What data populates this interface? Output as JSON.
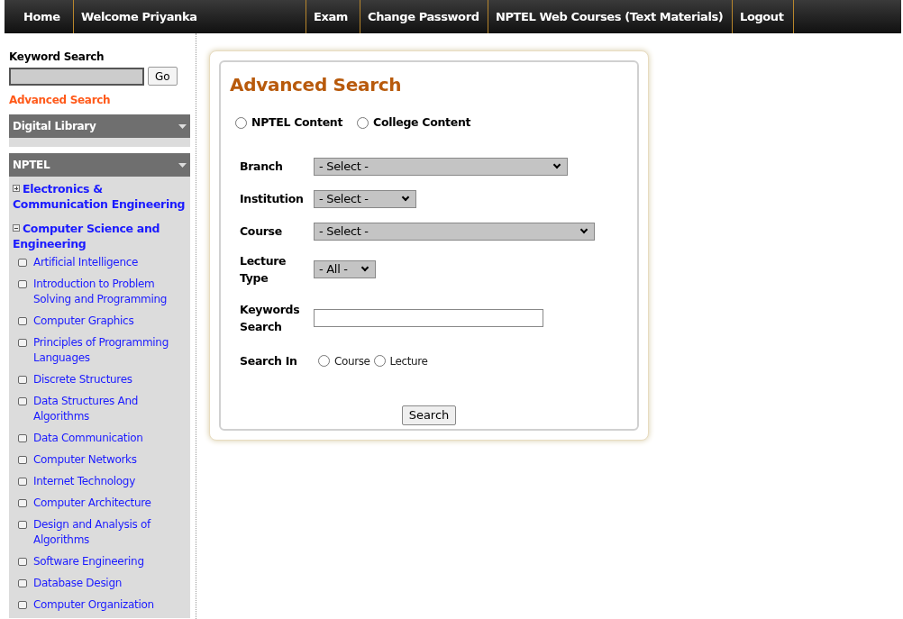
{
  "nav": [
    {
      "label": "Home"
    },
    {
      "label": "Welcome Priyanka"
    },
    {
      "label": "Exam"
    },
    {
      "label": "Change Password"
    },
    {
      "label": "NPTEL Web Courses (Text Materials)"
    },
    {
      "label": "Logout"
    }
  ],
  "sidebar": {
    "keyword_search": {
      "title": "Keyword Search",
      "button": "Go"
    },
    "advanced_search_link": "Advanced Search",
    "panels": [
      {
        "title": "Digital Library"
      },
      {
        "title": "NPTEL",
        "items": [
          {
            "label": "Electronics & Communication Engineering",
            "expanded": false
          },
          {
            "label": "Computer Science and Engineering",
            "expanded": true,
            "children": [
              {
                "label": "Artificial Intelligence"
              },
              {
                "label": "Introduction to Problem Solving and Programming"
              },
              {
                "label": "Computer Graphics"
              },
              {
                "label": "Principles of Programming Languages"
              },
              {
                "label": "Discrete Structures"
              },
              {
                "label": "Data Structures And Algorithms"
              },
              {
                "label": "Data Communication"
              },
              {
                "label": "Computer Networks"
              },
              {
                "label": "Internet Technology"
              },
              {
                "label": "Computer Architecture"
              },
              {
                "label": "Design and Analysis of Algorithms"
              },
              {
                "label": "Software Engineering"
              },
              {
                "label": "Database Design"
              },
              {
                "label": "Computer Organization"
              }
            ]
          }
        ]
      }
    ]
  },
  "form": {
    "title": "Advanced Search",
    "content_options": [
      {
        "label": "NPTEL Content",
        "selected": false
      },
      {
        "label": "College Content",
        "selected": false
      }
    ],
    "fields": [
      {
        "label": "Branch",
        "kind": "select",
        "value": "- Select -"
      },
      {
        "label": "Institution",
        "kind": "select",
        "value": "- Select -"
      },
      {
        "label": "Course",
        "kind": "select",
        "value": "- Select -"
      },
      {
        "label": "Lecture Type",
        "kind": "select",
        "value": "- All -"
      },
      {
        "label": "Keywords Search",
        "kind": "text"
      },
      {
        "label": "Search In",
        "kind": "radios",
        "options": [
          {
            "label": "Course",
            "selected": false
          },
          {
            "label": "Lecture",
            "selected": false
          }
        ]
      }
    ],
    "button": "Search"
  }
}
